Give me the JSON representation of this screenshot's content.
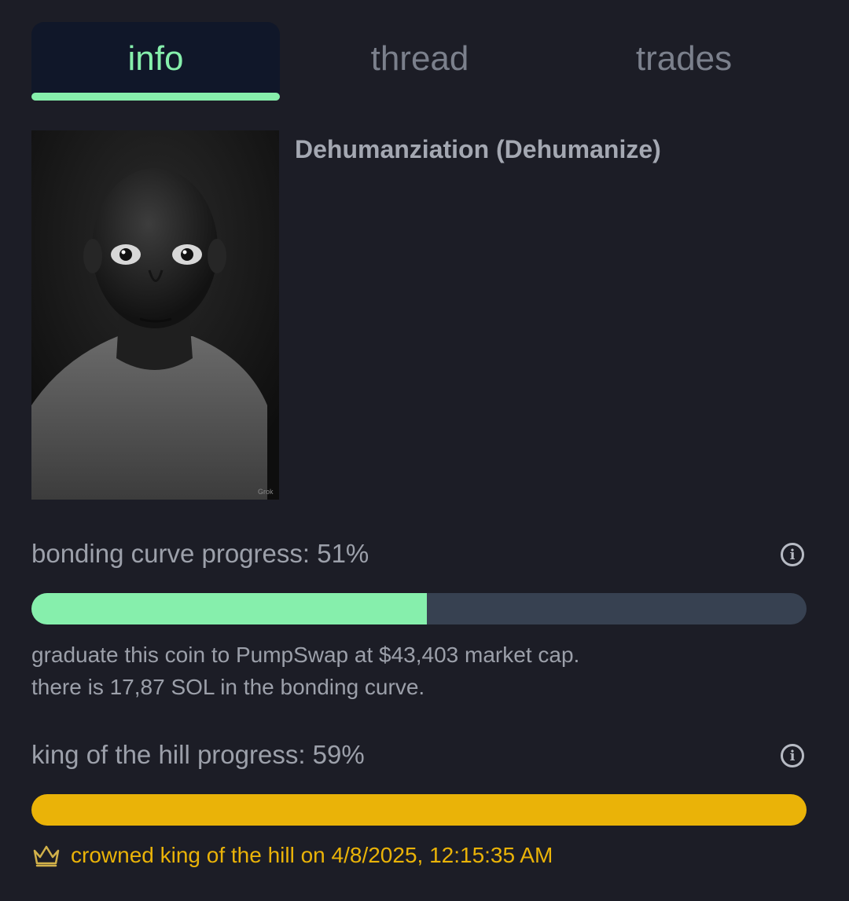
{
  "tabs": [
    {
      "label": "info",
      "active": true
    },
    {
      "label": "thread",
      "active": false
    },
    {
      "label": "trades",
      "active": false
    }
  ],
  "coin": {
    "title": "Dehumanziation (Dehumanize)",
    "image_alt": "coin image: grayscale portrait of a bald person with wide eyes",
    "watermark": "Grok"
  },
  "bonding_curve": {
    "label": "bonding curve progress: 51%",
    "progress": 0.51,
    "line1": "graduate this coin to PumpSwap at $43,403 market cap.",
    "line2": "there is 17,87 SOL in the bonding curve.",
    "info_icon": "info-circle-icon"
  },
  "king_of_the_hill": {
    "label": "king of the hill progress: 59%",
    "progress": 1.0,
    "crowned_text": "crowned king of the hill on 4/8/2025, 12:15:35 AM",
    "crown_icon": "crown-icon",
    "info_icon": "info-circle-icon"
  },
  "colors": {
    "background": "#1c1d26",
    "accent_green": "#86efac",
    "accent_yellow": "#eab308",
    "bar_track": "#374151",
    "active_tab_bg": "#101729"
  }
}
